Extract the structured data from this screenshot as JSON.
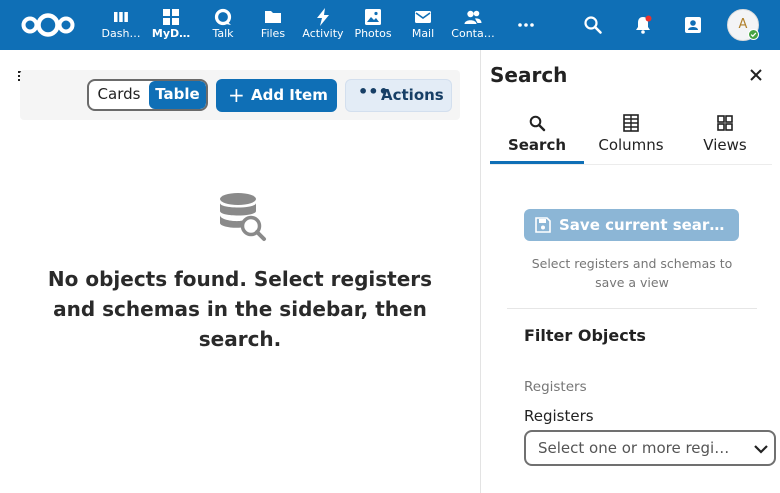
{
  "header": {
    "logo_icon": "nextcloud-logo-icon",
    "apps": [
      {
        "label": "Dash…",
        "icon": "dashboard-icon",
        "active": false
      },
      {
        "label": "MyD…",
        "icon": "grid-icon",
        "active": true
      },
      {
        "label": "Talk",
        "icon": "talk-icon",
        "active": false
      },
      {
        "label": "Files",
        "icon": "folder-icon",
        "active": false
      },
      {
        "label": "Activity",
        "icon": "lightning-icon",
        "active": false
      },
      {
        "label": "Photos",
        "icon": "image-icon",
        "active": false
      },
      {
        "label": "Mail",
        "icon": "mail-icon",
        "active": false
      },
      {
        "label": "Conta…",
        "icon": "contacts-icon",
        "active": false
      }
    ],
    "more_icon": "more-horizontal-icon",
    "right_icons": [
      "search-icon",
      "notifications-icon",
      "contacts-menu-icon"
    ],
    "avatar_initial": "A",
    "status": "online"
  },
  "toolbar": {
    "view_cards_label": "Cards",
    "view_table_label": "Table",
    "add_item_label": "Add Item",
    "actions_label": "Actions"
  },
  "main": {
    "empty_message": "No objects found. Select registers and schemas in the sidebar, then search."
  },
  "sidebar": {
    "title": "Search",
    "tabs": [
      {
        "label": "Search",
        "icon": "magnify-icon",
        "active": true
      },
      {
        "label": "Columns",
        "icon": "columns-icon",
        "active": false
      },
      {
        "label": "Views",
        "icon": "views-icon",
        "active": false
      }
    ],
    "save_view_label": "Save current sear…",
    "save_view_hint": "Select registers and schemas to save a view",
    "filter_heading": "Filter Objects",
    "registers_subheading": "Registers",
    "registers_label": "Registers",
    "registers_placeholder": "Select one or more regi…"
  },
  "colors": {
    "header_bg": "#0f6fb6",
    "primary": "#0f6fb6",
    "disabled_primary": "#8cb6d6",
    "online": "#46a343",
    "notification_dot": "#e9322d"
  }
}
